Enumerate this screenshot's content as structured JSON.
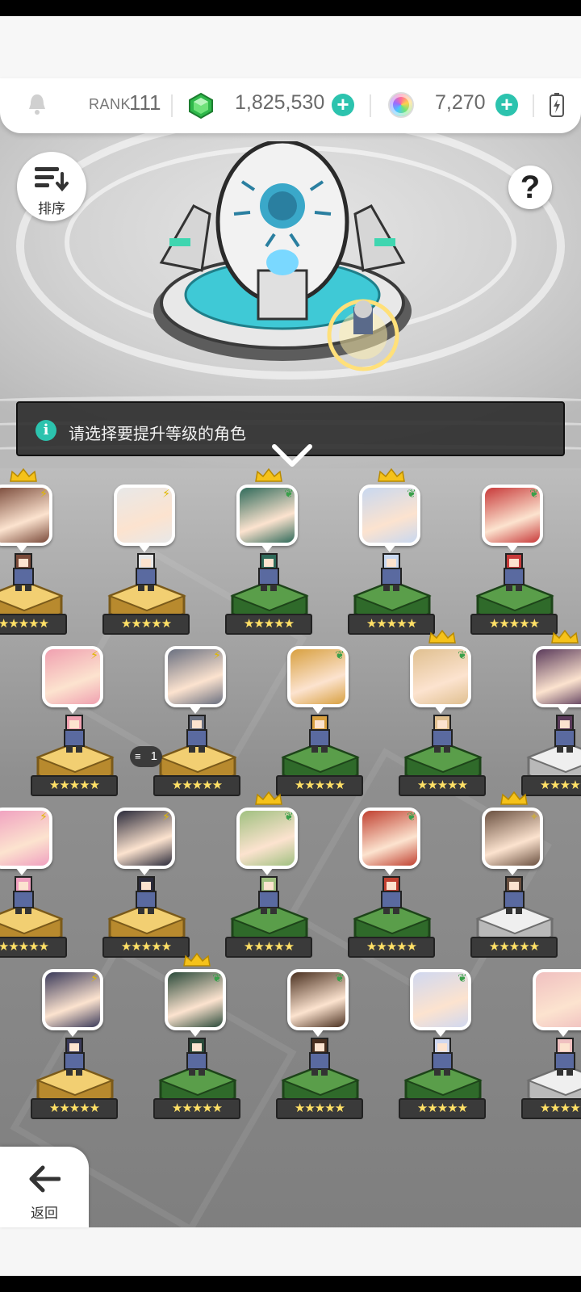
{
  "header": {
    "rank_label": "RANK",
    "rank_value": "111",
    "gems": "1,825,530",
    "orbs": "7,270",
    "accent_color": "#2cc3ae"
  },
  "buttons": {
    "sort_label": "排序",
    "back_label": "返回",
    "help_label": "?"
  },
  "banner": {
    "message": "请选择要提升等级的角色"
  },
  "characters": [
    {
      "row": 1,
      "col": 0,
      "element": "lightning",
      "pedestal": "gold",
      "crown": true,
      "stars": "★★★★★"
    },
    {
      "row": 1,
      "col": 1,
      "element": "lightning",
      "pedestal": "gold",
      "crown": false,
      "stars": "★★★★★"
    },
    {
      "row": 1,
      "col": 2,
      "element": "leaf",
      "pedestal": "green",
      "crown": true,
      "stars": "★★★★★"
    },
    {
      "row": 1,
      "col": 3,
      "element": "leaf",
      "pedestal": "green",
      "crown": true,
      "stars": "★★★★★"
    },
    {
      "row": 1,
      "col": 4,
      "element": "leaf",
      "pedestal": "green",
      "crown": false,
      "stars": "★★★★★"
    },
    {
      "row": 2,
      "col": 0,
      "element": "lightning",
      "pedestal": "gold",
      "crown": false,
      "stars": "★★★★★"
    },
    {
      "row": 2,
      "col": 1,
      "element": "lightning",
      "pedestal": "gold",
      "crown": false,
      "stars": "★★★★★",
      "badge": "1"
    },
    {
      "row": 2,
      "col": 2,
      "element": "leaf",
      "pedestal": "green",
      "crown": false,
      "stars": "★★★★★"
    },
    {
      "row": 2,
      "col": 3,
      "element": "leaf",
      "pedestal": "green",
      "crown": true,
      "stars": "★★★★★"
    },
    {
      "row": 2,
      "col": 4,
      "element": "light",
      "pedestal": "white",
      "crown": true,
      "stars": "★★★★★"
    },
    {
      "row": 3,
      "col": 0,
      "element": "lightning",
      "pedestal": "gold",
      "crown": false,
      "stars": "★★★★★"
    },
    {
      "row": 3,
      "col": 1,
      "element": "lightning",
      "pedestal": "gold",
      "crown": false,
      "stars": "★★★★★"
    },
    {
      "row": 3,
      "col": 2,
      "element": "leaf",
      "pedestal": "green",
      "crown": true,
      "stars": "★★★★★"
    },
    {
      "row": 3,
      "col": 3,
      "element": "leaf",
      "pedestal": "green",
      "crown": false,
      "stars": "★★★★★"
    },
    {
      "row": 3,
      "col": 4,
      "element": "light",
      "pedestal": "white",
      "crown": true,
      "stars": "★★★★★"
    },
    {
      "row": 4,
      "col": 0,
      "element": "lightning",
      "pedestal": "gold",
      "crown": false,
      "stars": "★★★★★"
    },
    {
      "row": 4,
      "col": 1,
      "element": "leaf",
      "pedestal": "green",
      "crown": true,
      "stars": "★★★★★"
    },
    {
      "row": 4,
      "col": 2,
      "element": "leaf",
      "pedestal": "green",
      "crown": false,
      "stars": "★★★★★"
    },
    {
      "row": 4,
      "col": 3,
      "element": "leaf",
      "pedestal": "green",
      "crown": false,
      "stars": "★★★★★"
    },
    {
      "row": 4,
      "col": 4,
      "element": "light",
      "pedestal": "white",
      "crown": false,
      "stars": "★★★★★"
    }
  ],
  "icons": [
    "bell-icon",
    "gem-icon",
    "orb-icon",
    "plus-icon",
    "battery-icon",
    "sort-icon",
    "help-icon",
    "info-icon",
    "chevron-down-icon",
    "back-arrow-icon",
    "crown-icon",
    "lightning-icon",
    "leaf-icon",
    "star-icon"
  ]
}
